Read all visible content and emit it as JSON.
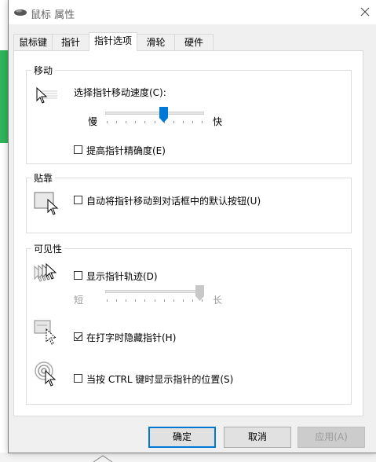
{
  "window": {
    "title": "鼠标 属性"
  },
  "tabs": [
    {
      "label": "鼠标键"
    },
    {
      "label": "指针"
    },
    {
      "label": "指针选项",
      "active": true
    },
    {
      "label": "滑轮"
    },
    {
      "label": "硬件"
    }
  ],
  "motion": {
    "group_label": "移动",
    "speed_label": "选择指针移动速度(C):",
    "slow_label": "慢",
    "fast_label": "快",
    "speed_level": 0.6,
    "precision_label": "提高指针精确度(E)",
    "precision_checked": false
  },
  "snap": {
    "group_label": "贴靠",
    "snap_label": "自动将指针移动到对话框中的默认按钮(U)",
    "snap_checked": false
  },
  "visibility": {
    "group_label": "可见性",
    "trails_label": "显示指针轨迹(D)",
    "trails_checked": false,
    "short_label": "短",
    "long_label": "长",
    "trail_length_level": 1.0,
    "hide_typing_label": "在打字时隐藏指针(H)",
    "hide_typing_checked": true,
    "ctrl_label": "当按 CTRL 键时显示指针的位置(S)",
    "ctrl_checked": false
  },
  "buttons": {
    "ok": "确定",
    "cancel": "取消",
    "apply": "应用(A)"
  },
  "colors": {
    "accent": "#0078d7",
    "background_green": "#2fb55a"
  }
}
